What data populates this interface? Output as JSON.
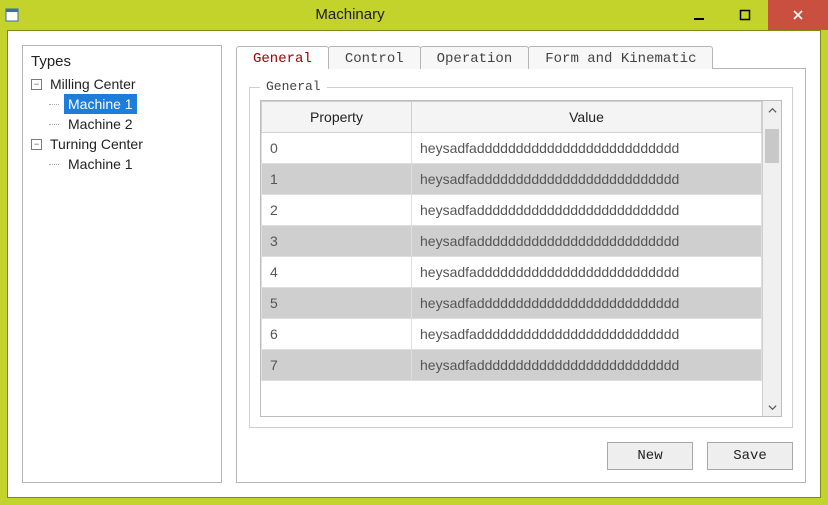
{
  "window": {
    "title": "Machinary"
  },
  "tree": {
    "title": "Types",
    "nodes": [
      {
        "label": "Milling Center",
        "expanded": true,
        "children": [
          {
            "label": "Machine 1",
            "selected": true
          },
          {
            "label": "Machine 2"
          }
        ]
      },
      {
        "label": "Turning Center",
        "expanded": true,
        "children": [
          {
            "label": "Machine 1"
          }
        ]
      }
    ]
  },
  "tabs": [
    {
      "id": "general",
      "label": "General",
      "active": true
    },
    {
      "id": "control",
      "label": "Control",
      "active": false
    },
    {
      "id": "operation",
      "label": "Operation",
      "active": false
    },
    {
      "id": "formkin",
      "label": "Form and Kinematic",
      "active": false
    }
  ],
  "group": {
    "legend": "General",
    "columns": {
      "property": "Property",
      "value": "Value"
    },
    "rows": [
      {
        "property": "0",
        "value": "heysadfadddddddddddddddddddddddddd"
      },
      {
        "property": "1",
        "value": "heysadfadddddddddddddddddddddddddd"
      },
      {
        "property": "2",
        "value": "heysadfadddddddddddddddddddddddddd"
      },
      {
        "property": "3",
        "value": "heysadfadddddddddddddddddddddddddd"
      },
      {
        "property": "4",
        "value": "heysadfadddddddddddddddddddddddddd"
      },
      {
        "property": "5",
        "value": "heysadfadddddddddddddddddddddddddd"
      },
      {
        "property": "6",
        "value": "heysadfadddddddddddddddddddddddddd"
      },
      {
        "property": "7",
        "value": "heysadfadddddddddddddddddddddddddd"
      }
    ]
  },
  "buttons": {
    "new": "New",
    "save": "Save"
  }
}
